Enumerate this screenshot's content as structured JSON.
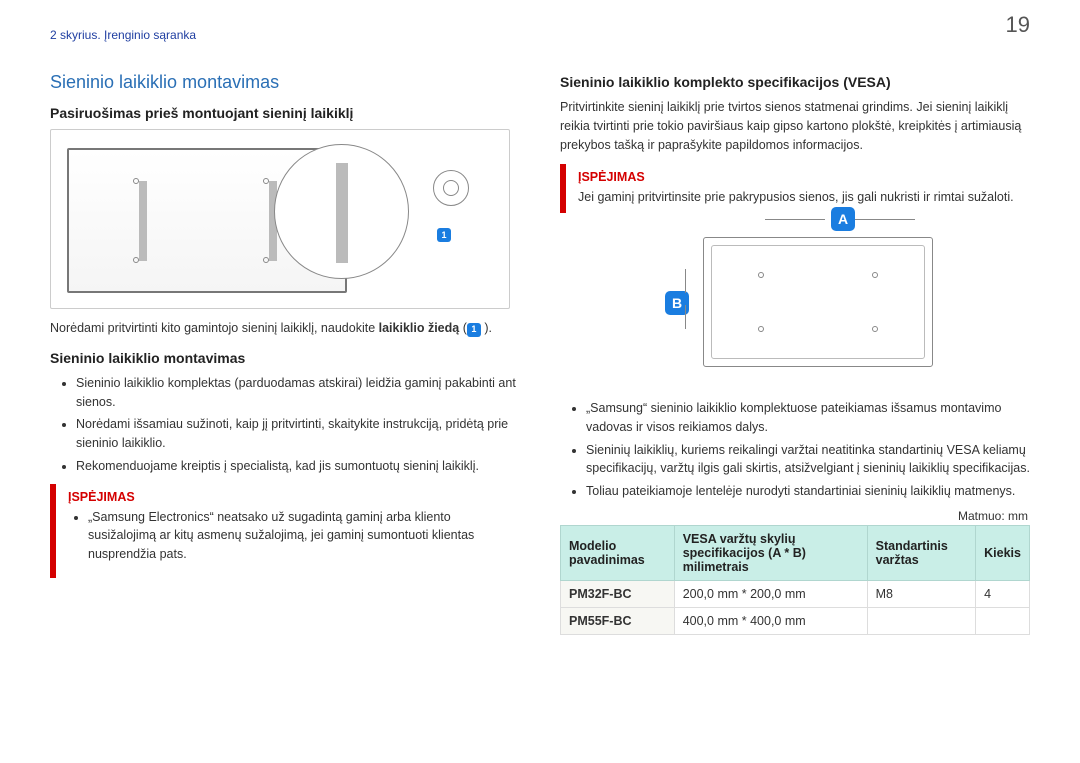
{
  "page_number": "19",
  "breadcrumb": "2 skyrius. Įrenginio sąranka",
  "left": {
    "title": "Sieninio laikiklio montavimas",
    "prep_heading": "Pasiruošimas prieš montuojant sieninį laikiklį",
    "badge_inline": "1",
    "note_before": "Norėdami pritvirtinti kito gamintojo sieninį laikiklį, naudokite ",
    "note_strong": "laikiklio žiedą",
    "note_paren_open": " (",
    "note_paren_close": " ).",
    "mount_heading": "Sieninio laikiklio montavimas",
    "bullets": [
      "Sieninio laikiklio komplektas (parduodamas atskirai) leidžia gaminį pakabinti ant sienos.",
      "Norėdami išsamiau sužinoti, kaip jį pritvirtinti, skaitykite instrukciją, pridėtą prie sieninio laikiklio.",
      "Rekomenduojame kreiptis į specialistą, kad jis sumontuotų sieninį laikiklį."
    ],
    "warn_title": "ĮSPĖJIMAS",
    "warn_body": "„Samsung Electronics“ neatsako už sugadintą gaminį arba kliento susižalojimą ar kitų asmenų sužalojimą, jei gaminį sumontuoti klientas nusprendžia pats."
  },
  "right": {
    "spec_heading": "Sieninio laikiklio komplekto specifikacijos (VESA)",
    "intro": "Pritvirtinkite sieninį laikiklį prie tvirtos sienos statmenai grindims. Jei sieninį laikiklį reikia tvirtinti prie tokio paviršiaus kaip gipso kartono plokštė, kreipkitės į artimiausią prekybos tašką ir paprašykite papildomos informacijos.",
    "warn_title": "ĮSPĖJIMAS",
    "warn_body": "Jei gaminį pritvirtinsite prie pakrypusios sienos, jis gali nukristi ir rimtai sužaloti.",
    "label_a": "A",
    "label_b": "B",
    "bullets": [
      "„Samsung“ sieninio laikiklio komplektuose pateikiamas išsamus montavimo vadovas ir visos reikiamos dalys.",
      "Sieninių laikiklių, kuriems reikalingi varžtai neatitinka standartinių VESA keliamų specifikacijų, varžtų ilgis gali skirtis, atsižvelgiant į sieninių laikiklių specifikacijas.",
      "Toliau pateikiamoje lentelėje nurodyti standartiniai sieninių laikiklių matmenys."
    ],
    "unit_label": "Matmuo: mm",
    "table": {
      "headers": {
        "model": "Modelio pavadinimas",
        "vesa": "VESA varžtų skylių specifikacijos (A * B) milimetrais",
        "screw": "Standartinis varžtas",
        "qty": "Kiekis"
      },
      "rows": [
        {
          "model": "PM32F-BC",
          "vesa": "200,0 mm * 200,0 mm",
          "screw": "M8",
          "qty": "4"
        },
        {
          "model": "PM55F-BC",
          "vesa": "400,0 mm * 400,0 mm",
          "screw": "",
          "qty": ""
        }
      ]
    }
  }
}
